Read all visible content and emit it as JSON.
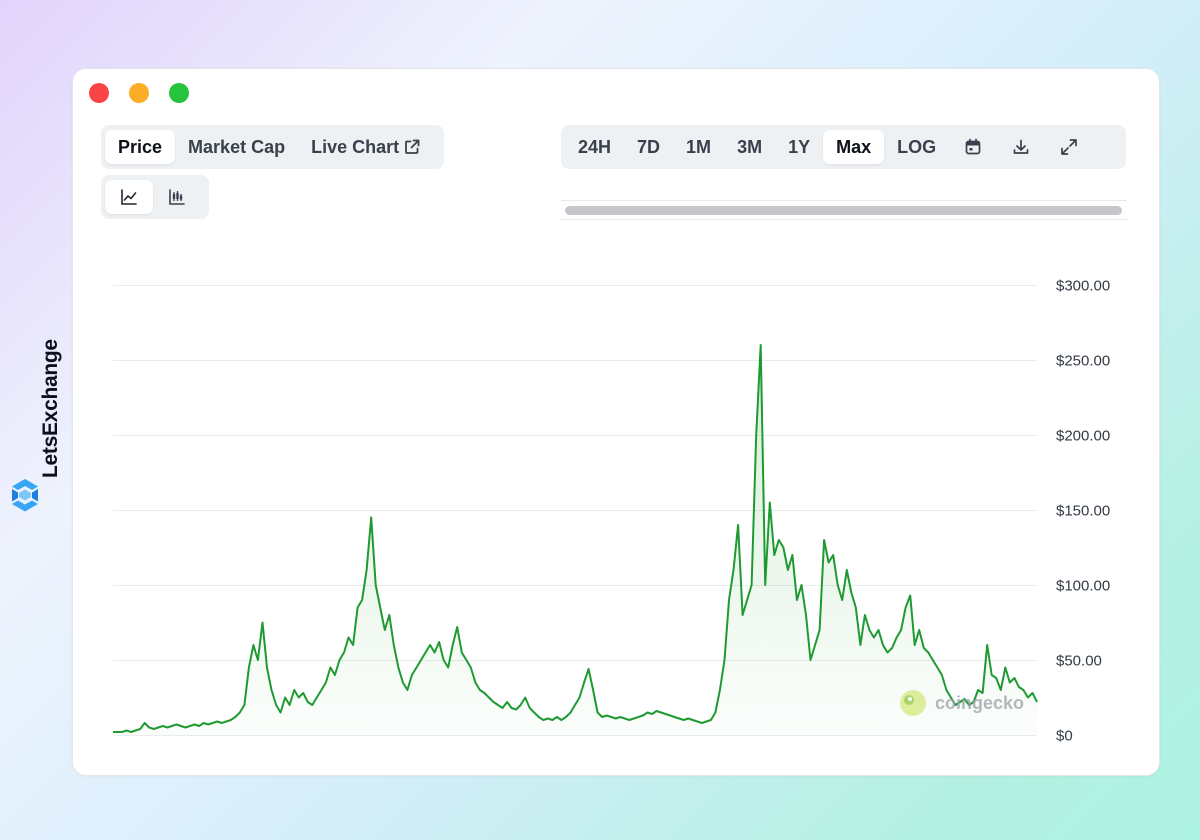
{
  "brand": {
    "name": "LetsExchange"
  },
  "window": {
    "metric_tabs": [
      {
        "label": "Price",
        "active": true
      },
      {
        "label": "Market Cap",
        "active": false
      },
      {
        "label": "Live Chart",
        "active": false
      }
    ],
    "chart_types": [
      {
        "icon": "line-chart-icon",
        "active": true
      },
      {
        "icon": "candlestick-chart-icon",
        "active": false
      }
    ],
    "range_tabs": [
      {
        "label": "24H",
        "active": false
      },
      {
        "label": "7D",
        "active": false
      },
      {
        "label": "1M",
        "active": false
      },
      {
        "label": "3M",
        "active": false
      },
      {
        "label": "1Y",
        "active": false
      },
      {
        "label": "Max",
        "active": true
      },
      {
        "label": "LOG",
        "active": false
      }
    ],
    "tool_icons": [
      "calendar-icon",
      "download-icon",
      "expand-icon"
    ]
  },
  "watermark": {
    "text": "coingecko"
  },
  "colors": {
    "line": "#1f9a32",
    "accent": "#26c33d"
  },
  "chart_data": {
    "type": "area",
    "title": "",
    "xlabel": "",
    "ylabel": "",
    "ylim": [
      0,
      300
    ],
    "y_ticks": [
      {
        "value": 0,
        "label": "$0"
      },
      {
        "value": 50,
        "label": "$50.00"
      },
      {
        "value": 100,
        "label": "$100.00"
      },
      {
        "value": 150,
        "label": "$150.00"
      },
      {
        "value": 200,
        "label": "$200.00"
      },
      {
        "value": 250,
        "label": "$250.00"
      },
      {
        "value": 300,
        "label": "$300.00"
      }
    ],
    "grid": true,
    "series": [
      {
        "values": [
          2,
          2,
          2,
          3,
          2,
          3,
          4,
          8,
          5,
          4,
          5,
          6,
          5,
          6,
          7,
          6,
          5,
          6,
          7,
          6,
          8,
          7,
          8,
          9,
          8,
          9,
          10,
          12,
          15,
          20,
          45,
          60,
          50,
          75,
          45,
          30,
          20,
          15,
          25,
          20,
          30,
          25,
          28,
          22,
          20,
          25,
          30,
          35,
          45,
          40,
          50,
          55,
          65,
          60,
          85,
          90,
          110,
          145,
          100,
          85,
          70,
          80,
          60,
          45,
          35,
          30,
          40,
          45,
          50,
          55,
          60,
          55,
          62,
          50,
          45,
          60,
          72,
          55,
          50,
          45,
          35,
          30,
          28,
          25,
          22,
          20,
          18,
          22,
          18,
          17,
          20,
          25,
          18,
          15,
          12,
          10,
          11,
          10,
          12,
          10,
          12,
          15,
          20,
          25,
          35,
          44,
          30,
          15,
          12,
          13,
          12,
          11,
          12,
          11,
          10,
          11,
          12,
          13,
          15,
          14,
          16,
          15,
          14,
          13,
          12,
          11,
          10,
          11,
          10,
          9,
          8,
          9,
          10,
          15,
          30,
          50,
          90,
          110,
          140,
          80,
          90,
          100,
          200,
          260,
          100,
          155,
          120,
          130,
          125,
          110,
          120,
          90,
          100,
          80,
          50,
          60,
          70,
          130,
          115,
          120,
          100,
          90,
          110,
          95,
          85,
          60,
          80,
          70,
          65,
          70,
          60,
          55,
          58,
          65,
          70,
          85,
          93,
          60,
          70,
          58,
          55,
          50,
          45,
          40,
          30,
          25,
          20,
          22,
          24,
          20,
          22,
          30,
          28,
          60,
          40,
          38,
          30,
          45,
          35,
          38,
          32,
          30,
          25,
          28,
          22
        ]
      }
    ]
  }
}
